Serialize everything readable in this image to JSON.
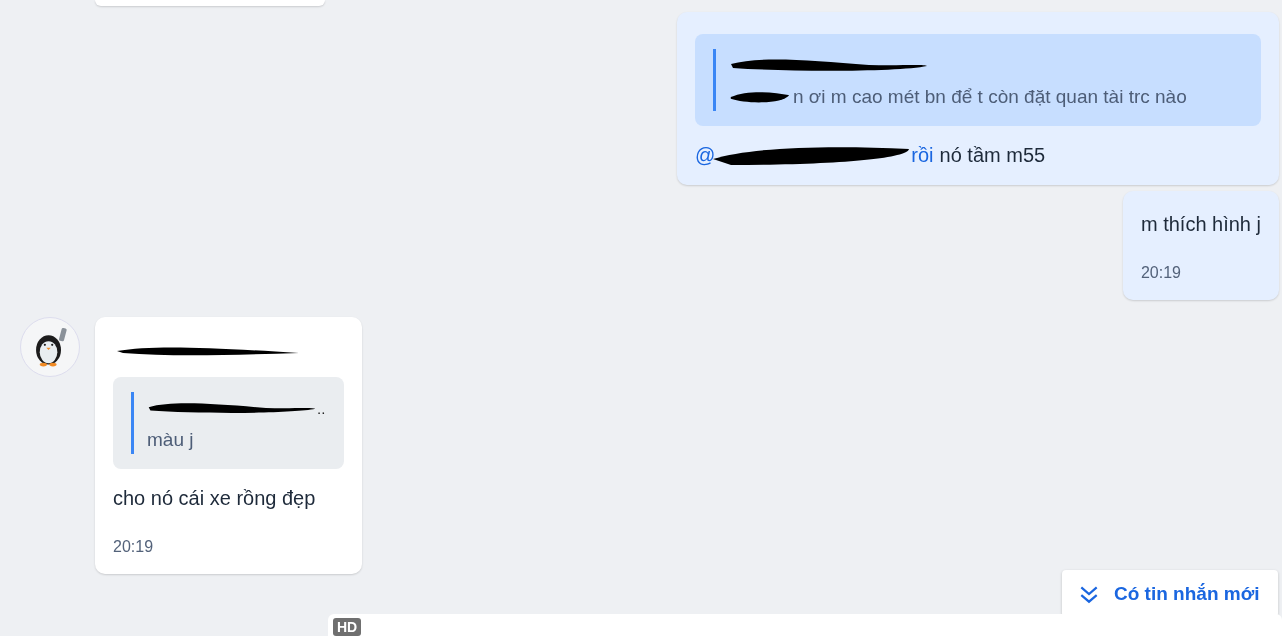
{
  "messages": [
    {
      "kind": "outgoing",
      "quote": {
        "text": "n ơi m cao mét bn để t còn đặt quan tài trc nào"
      },
      "mention_start": "@",
      "mention_end": "rồi",
      "text": "nó tầm m55"
    },
    {
      "kind": "outgoing",
      "text": "m thích hình j",
      "time": "20:19"
    },
    {
      "kind": "incoming",
      "avatar": true,
      "quote": {
        "text": "màu j",
        "title_tail": ".."
      },
      "text": "cho nó cái xe rồng đẹp",
      "time": "20:19"
    }
  ],
  "new_messages_button": {
    "label": "Có tin nhắn mới"
  },
  "next_card": {
    "badge": "HD"
  }
}
